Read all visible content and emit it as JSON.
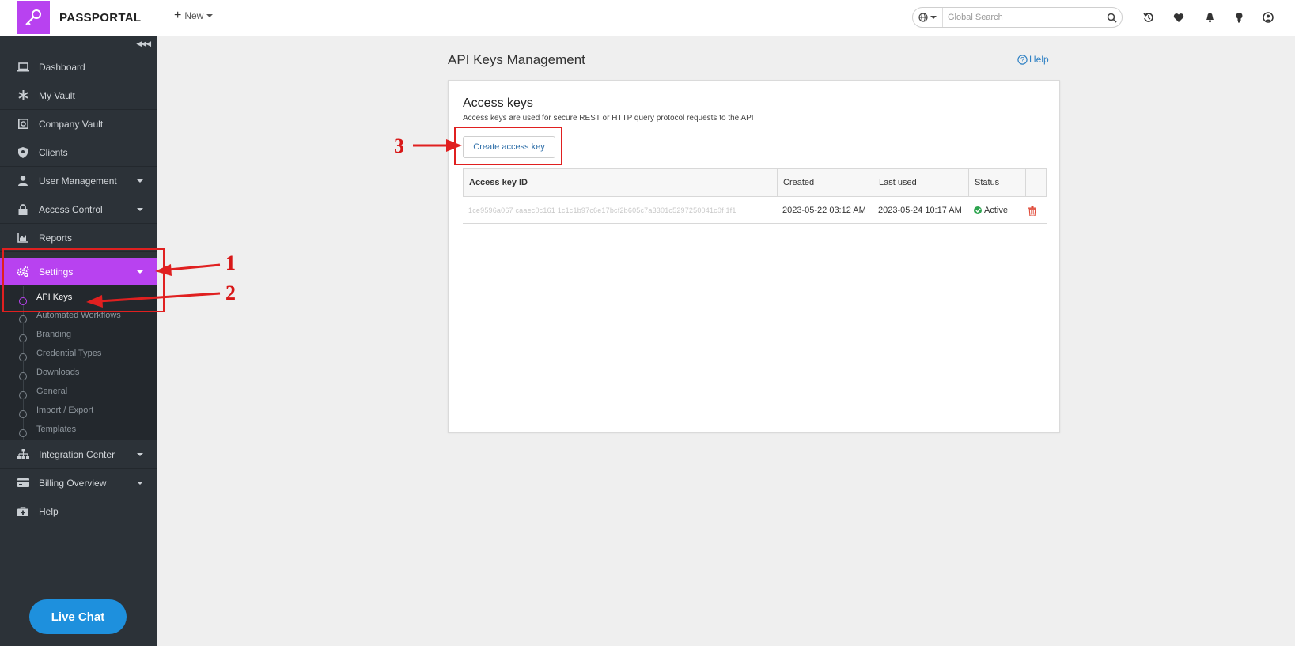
{
  "app": {
    "brand": "PASSPORTAL",
    "new_label": "New",
    "accent": "#b842f0"
  },
  "search": {
    "placeholder": "Global Search"
  },
  "top_icons": [
    "history-icon",
    "heart-icon",
    "bell-icon",
    "lightbulb-icon",
    "user-circle-icon"
  ],
  "sidebar": {
    "items": [
      {
        "label": "Dashboard",
        "icon": "laptop-icon"
      },
      {
        "label": "My Vault",
        "icon": "asterisk-icon"
      },
      {
        "label": "Company Vault",
        "icon": "safe-icon"
      },
      {
        "label": "Clients",
        "icon": "shield-icon"
      },
      {
        "label": "User Management",
        "icon": "user-icon"
      },
      {
        "label": "Access Control",
        "icon": "lock-icon"
      },
      {
        "label": "Reports",
        "icon": "chart-icon"
      },
      {
        "label": "Settings",
        "icon": "gears-icon"
      },
      {
        "label": "Integration Center",
        "icon": "sitemap-icon"
      },
      {
        "label": "Billing Overview",
        "icon": "credit-card-icon"
      },
      {
        "label": "Help",
        "icon": "medkit-icon"
      }
    ],
    "settings_sub": [
      "API Keys",
      "Automated Workflows",
      "Branding",
      "Credential Types",
      "Downloads",
      "General",
      "Import / Export",
      "Templates"
    ]
  },
  "live_chat": "Live Chat",
  "main": {
    "title": "API Keys Management",
    "help": "Help",
    "card": {
      "title": "Access keys",
      "subtitle": "Access keys are used for secure REST or HTTP query protocol requests to the API",
      "create_button": "Create access key"
    },
    "table": {
      "headers": [
        "Access key ID",
        "Created",
        "Last used",
        "Status"
      ],
      "rows": [
        {
          "key_id": "1ce9596a067 caaec0c161 1c1c1b97c6e17bcf2b605c7a3301c5297250041c0f 1f1",
          "created": "2023-05-22 03:12 AM",
          "last_used": "2023-05-24 10:17 AM",
          "status": "Active"
        }
      ]
    }
  },
  "annotations": [
    "1",
    "2",
    "3"
  ]
}
